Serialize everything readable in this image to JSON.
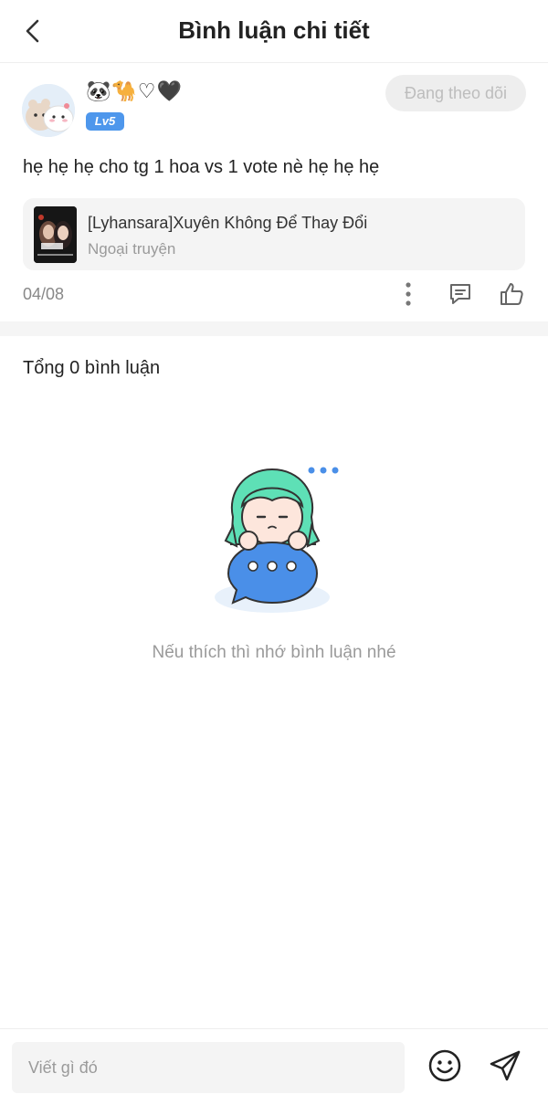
{
  "header": {
    "title": "Bình luận chi tiết"
  },
  "comment": {
    "username": "🐼🐪♡🖤",
    "level": "Lv5",
    "follow_label": "Đang theo dõi",
    "text": "hẹ hẹ hẹ cho tg 1 hoa vs 1 vote nè hẹ hẹ hẹ",
    "date": "04/08"
  },
  "story": {
    "title": "[Lyhansara]Xuyên Không Để Thay Đổi",
    "subtitle": "Ngoại truyện"
  },
  "comments_section": {
    "total_label": "Tổng 0 bình luận",
    "empty_message": "Nếu thích thì nhớ bình luận nhé"
  },
  "input": {
    "placeholder": "Viết gì đó"
  },
  "colors": {
    "accent": "#4e97ec",
    "mascot_hair": "#5ee0b6",
    "bubble": "#4a8fe8",
    "muted_text": "#9a9a9a"
  },
  "icons": {
    "back": "chevron-left-icon",
    "more": "more-vertical-icon",
    "reply": "comment-icon",
    "like": "thumbs-up-icon",
    "emoji": "smiley-icon",
    "send": "send-icon"
  }
}
